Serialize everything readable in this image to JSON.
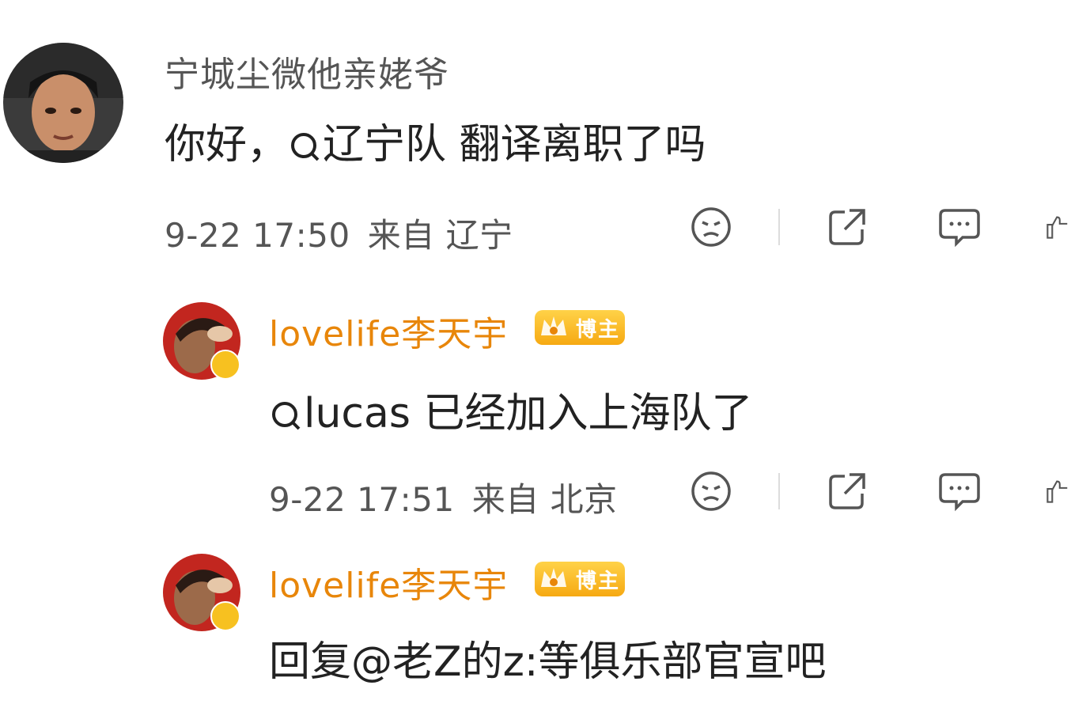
{
  "comments": [
    {
      "author": "宁城尘微他亲姥爷",
      "body_prefix": "你好，",
      "mention": "辽宁队",
      "body_suffix": " 翻译离职了吗",
      "time": "9-22 17:50",
      "from_label": "来自",
      "location": "辽宁"
    },
    {
      "author": "lovelife李天宇",
      "badge": "博主",
      "mention": "lucas",
      "body_suffix": " 已经加入上海队了",
      "time": "9-22 17:51",
      "from_label": "来自",
      "location": "北京"
    },
    {
      "author": "lovelife李天宇",
      "badge": "博主",
      "body": "回复@老Z的z:等俱乐部官宣吧"
    }
  ],
  "colors": {
    "author_gray": "#555555",
    "author_orange": "#e8860a",
    "badge": "#f6a912"
  },
  "icons": [
    "dislike-face-icon",
    "share-icon",
    "comment-icon",
    "like-icon",
    "search-mention-icon",
    "verified-icon"
  ]
}
